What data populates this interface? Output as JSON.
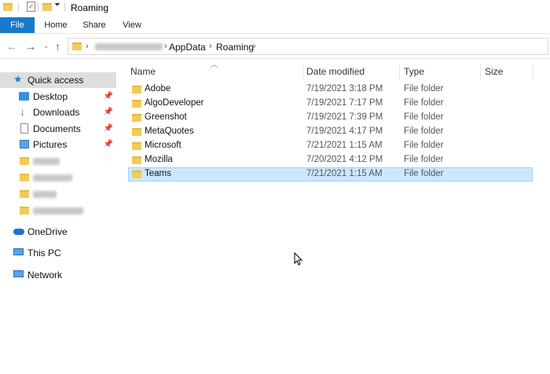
{
  "window": {
    "title": "Roaming"
  },
  "ribbon": {
    "tabs": [
      "File",
      "Home",
      "Share",
      "View"
    ]
  },
  "address": {
    "crumbs": [
      "AppData",
      "Roaming"
    ]
  },
  "nav": {
    "quick_access": "Quick access",
    "items": [
      "Desktop",
      "Downloads",
      "Documents",
      "Pictures"
    ],
    "onedrive": "OneDrive",
    "thispc": "This PC",
    "network": "Network"
  },
  "columns": {
    "name": "Name",
    "date": "Date modified",
    "type": "Type",
    "size": "Size"
  },
  "files": [
    {
      "name": "Adobe",
      "date": "7/19/2021 3:18 PM",
      "type": "File folder"
    },
    {
      "name": "AlgoDeveloper",
      "date": "7/19/2021 7:17 PM",
      "type": "File folder"
    },
    {
      "name": "Greenshot",
      "date": "7/19/2021 7:39 PM",
      "type": "File folder"
    },
    {
      "name": "MetaQuotes",
      "date": "7/19/2021 4:17 PM",
      "type": "File folder"
    },
    {
      "name": "Microsoft",
      "date": "7/21/2021 1:15 AM",
      "type": "File folder"
    },
    {
      "name": "Mozilla",
      "date": "7/20/2021 4:12 PM",
      "type": "File folder"
    },
    {
      "name": "Teams",
      "date": "7/21/2021 1:15 AM",
      "type": "File folder",
      "selected": true
    }
  ],
  "colors": {
    "accent": "#1979ca",
    "selection": "#cce8ff",
    "folder": "#f2cc5b"
  }
}
